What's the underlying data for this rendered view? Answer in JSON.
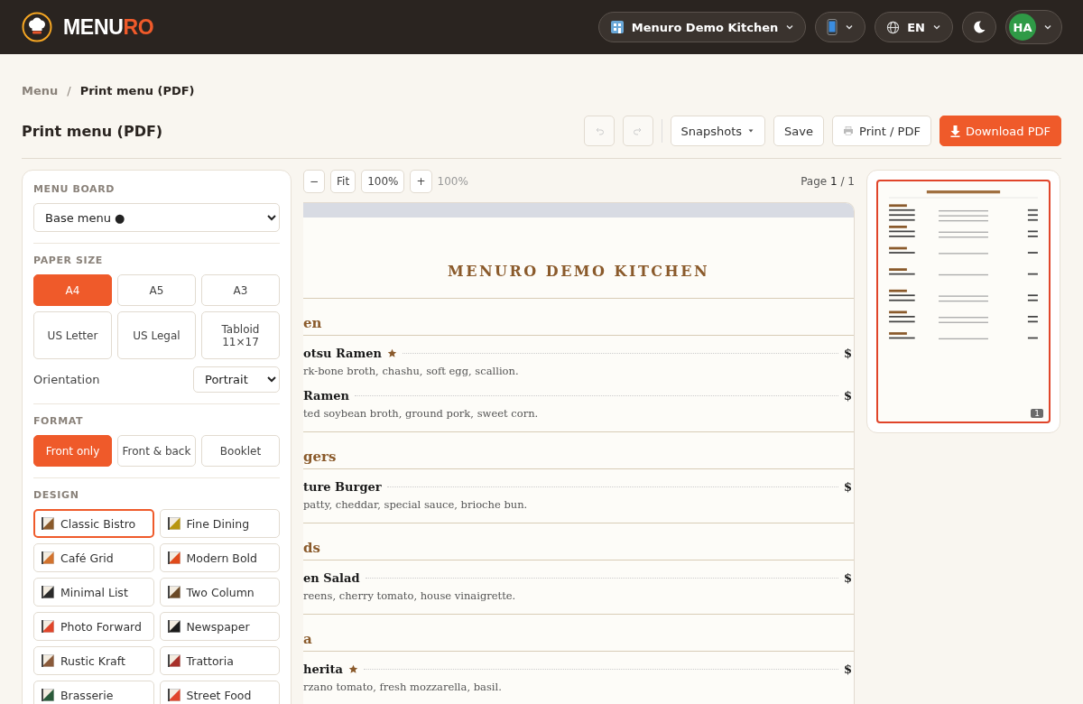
{
  "header": {
    "logo": {
      "main": "MENU",
      "accent": "RO"
    },
    "restaurant": "Menuro Demo Kitchen",
    "language": "EN",
    "avatar": "HA"
  },
  "breadcrumb_separator": "/",
  "breadcrumb": [
    {
      "label": "Menu",
      "current": false
    },
    {
      "label": "Print menu (PDF)",
      "current": true
    }
  ],
  "page_title": "Print menu (PDF)",
  "toolbar": {
    "undo_disabled": true,
    "redo_disabled": true,
    "snapshots": "Snapshots",
    "save": "Save",
    "print": "Print / PDF",
    "download": "Download PDF"
  },
  "sidebar": {
    "menu_board": {
      "label": "MENU BOARD",
      "value": "Base menu ●"
    },
    "paper_size": {
      "label": "PAPER SIZE",
      "options": [
        {
          "label": "A4",
          "selected": true
        },
        {
          "label": "A5",
          "selected": false
        },
        {
          "label": "A3",
          "selected": false
        },
        {
          "label": "US Letter",
          "selected": false
        },
        {
          "label": "US Legal",
          "selected": false
        },
        {
          "label": "Tabloid 11×17",
          "selected": false
        }
      ]
    },
    "orientation": {
      "label": "Orientation",
      "value": "Portrait"
    },
    "format": {
      "label": "FORMAT",
      "options": [
        {
          "label": "Front only",
          "selected": true
        },
        {
          "label": "Front & back",
          "selected": false
        },
        {
          "label": "Booklet",
          "selected": false
        }
      ]
    },
    "design": {
      "label": "DESIGN",
      "options": [
        {
          "label": "Classic Bistro",
          "selected": true,
          "color": "#8a5a2b"
        },
        {
          "label": "Fine Dining",
          "selected": false,
          "color": "#b8960f"
        },
        {
          "label": "Café Grid",
          "selected": false,
          "color": "#d2732e"
        },
        {
          "label": "Modern Bold",
          "selected": false,
          "color": "#e04a1a"
        },
        {
          "label": "Minimal List",
          "selected": false,
          "color": "#2a2a2a"
        },
        {
          "label": "Two Column",
          "selected": false,
          "color": "#6b4a26"
        },
        {
          "label": "Photo Forward",
          "selected": false,
          "color": "#e0452a"
        },
        {
          "label": "Newspaper",
          "selected": false,
          "color": "#1a1a1a"
        },
        {
          "label": "Rustic Kraft",
          "selected": false,
          "color": "#8a5a3a"
        },
        {
          "label": "Trattoria",
          "selected": false,
          "color": "#a8302a"
        },
        {
          "label": "Brasserie",
          "selected": false,
          "color": "#2a5a3a"
        },
        {
          "label": "Street Food",
          "selected": false,
          "color": "#e0452a"
        }
      ]
    }
  },
  "preview": {
    "zoom_out": "−",
    "fit": "Fit",
    "zoom_reset": "100%",
    "zoom_in": "+",
    "zoom_level": "100%",
    "page_indicator": "Page **1** / 1",
    "menu_title": "MENURO DEMO KITCHEN",
    "sections": [
      {
        "heading": "en",
        "items": [
          {
            "name": "otsu Ramen",
            "featured": true,
            "description": "rk-bone broth, chashu, soft egg, scallion.",
            "price": "$"
          },
          {
            "name": "Ramen",
            "featured": false,
            "description": "ted soybean broth, ground pork, sweet corn.",
            "price": "$"
          }
        ]
      },
      {
        "heading": "gers",
        "items": [
          {
            "name": "ture Burger",
            "featured": false,
            "description": "patty, cheddar, special sauce, brioche bun.",
            "price": "$"
          }
        ]
      },
      {
        "heading": "ds",
        "items": [
          {
            "name": "en Salad",
            "featured": false,
            "description": "reens, cherry tomato, house vinaigrette.",
            "price": "$"
          }
        ]
      },
      {
        "heading": "a",
        "items": [
          {
            "name": "herita",
            "featured": true,
            "description": "rzano tomato, fresh mozzarella, basil.",
            "price": "$"
          }
        ]
      }
    ],
    "thumbnail": {
      "page_number": "1",
      "selected": true
    }
  }
}
